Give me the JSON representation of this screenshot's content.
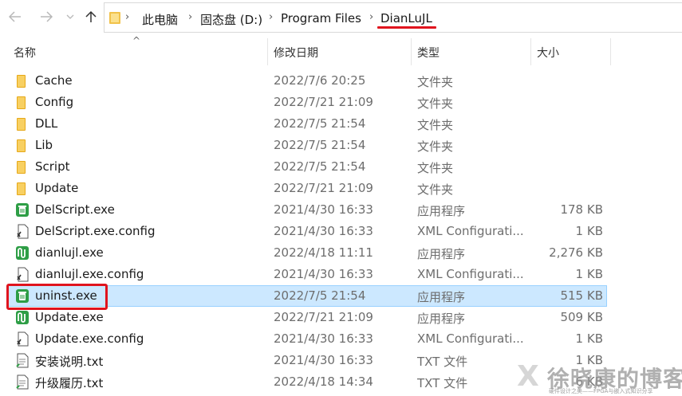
{
  "nav": {
    "back_icon": "arrow-left-icon",
    "forward_icon": "arrow-right-icon",
    "recent_icon": "chevron-down-icon",
    "up_icon": "arrow-up-icon"
  },
  "breadcrumb": [
    "此电脑",
    "固态盘 (D:)",
    "Program Files",
    "DianLuJL"
  ],
  "columns": {
    "name": "名称",
    "date": "修改日期",
    "type": "类型",
    "size": "大小"
  },
  "accent": {
    "highlight": "#e0141e",
    "selection_bg": "#cce8ff",
    "selection_border": "#99d1ff"
  },
  "files": [
    {
      "name": "Cache",
      "date": "2022/7/6 20:25",
      "type": "文件夹",
      "size": "",
      "icon": "folder-icon"
    },
    {
      "name": "Config",
      "date": "2022/7/21 21:09",
      "type": "文件夹",
      "size": "",
      "icon": "folder-icon"
    },
    {
      "name": "DLL",
      "date": "2022/7/5 21:54",
      "type": "文件夹",
      "size": "",
      "icon": "folder-icon"
    },
    {
      "name": "Lib",
      "date": "2022/7/5 21:54",
      "type": "文件夹",
      "size": "",
      "icon": "folder-icon"
    },
    {
      "name": "Script",
      "date": "2022/7/5 21:54",
      "type": "文件夹",
      "size": "",
      "icon": "folder-icon"
    },
    {
      "name": "Update",
      "date": "2022/7/21 21:09",
      "type": "文件夹",
      "size": "",
      "icon": "folder-icon"
    },
    {
      "name": "DelScript.exe",
      "date": "2021/4/30 16:33",
      "type": "应用程序",
      "size": "178 KB",
      "icon": "trash-app-icon"
    },
    {
      "name": "DelScript.exe.config",
      "date": "2021/4/30 16:33",
      "type": "XML Configurati...",
      "size": "1 KB",
      "icon": "config-file-icon"
    },
    {
      "name": "dianlujl.exe",
      "date": "2022/4/18 11:11",
      "type": "应用程序",
      "size": "2,276 KB",
      "icon": "circuit-app-icon"
    },
    {
      "name": "dianlujl.exe.config",
      "date": "2021/4/30 16:33",
      "type": "XML Configurati...",
      "size": "1 KB",
      "icon": "config-file-icon"
    },
    {
      "name": "uninst.exe",
      "date": "2022/7/5 21:54",
      "type": "应用程序",
      "size": "515 KB",
      "icon": "trash-app-icon",
      "selected": true
    },
    {
      "name": "Update.exe",
      "date": "2022/7/21 21:09",
      "type": "应用程序",
      "size": "509 KB",
      "icon": "circuit-app-icon"
    },
    {
      "name": "Update.exe.config",
      "date": "2021/4/30 16:33",
      "type": "XML Configurati...",
      "size": "1 KB",
      "icon": "config-file-icon"
    },
    {
      "name": "安装说明.txt",
      "date": "2021/4/30 16:33",
      "type": "TXT 文件",
      "size": "1 KB",
      "icon": "text-file-icon"
    },
    {
      "name": "升级履历.txt",
      "date": "2022/4/18 14:34",
      "type": "TXT 文件",
      "size": "6 KB",
      "icon": "text-file-icon"
    }
  ],
  "watermark": {
    "mark": "X",
    "title": "徐晓康的博客",
    "subtitle": "硬件设计之美——FPGA与嵌入式知识分享"
  }
}
